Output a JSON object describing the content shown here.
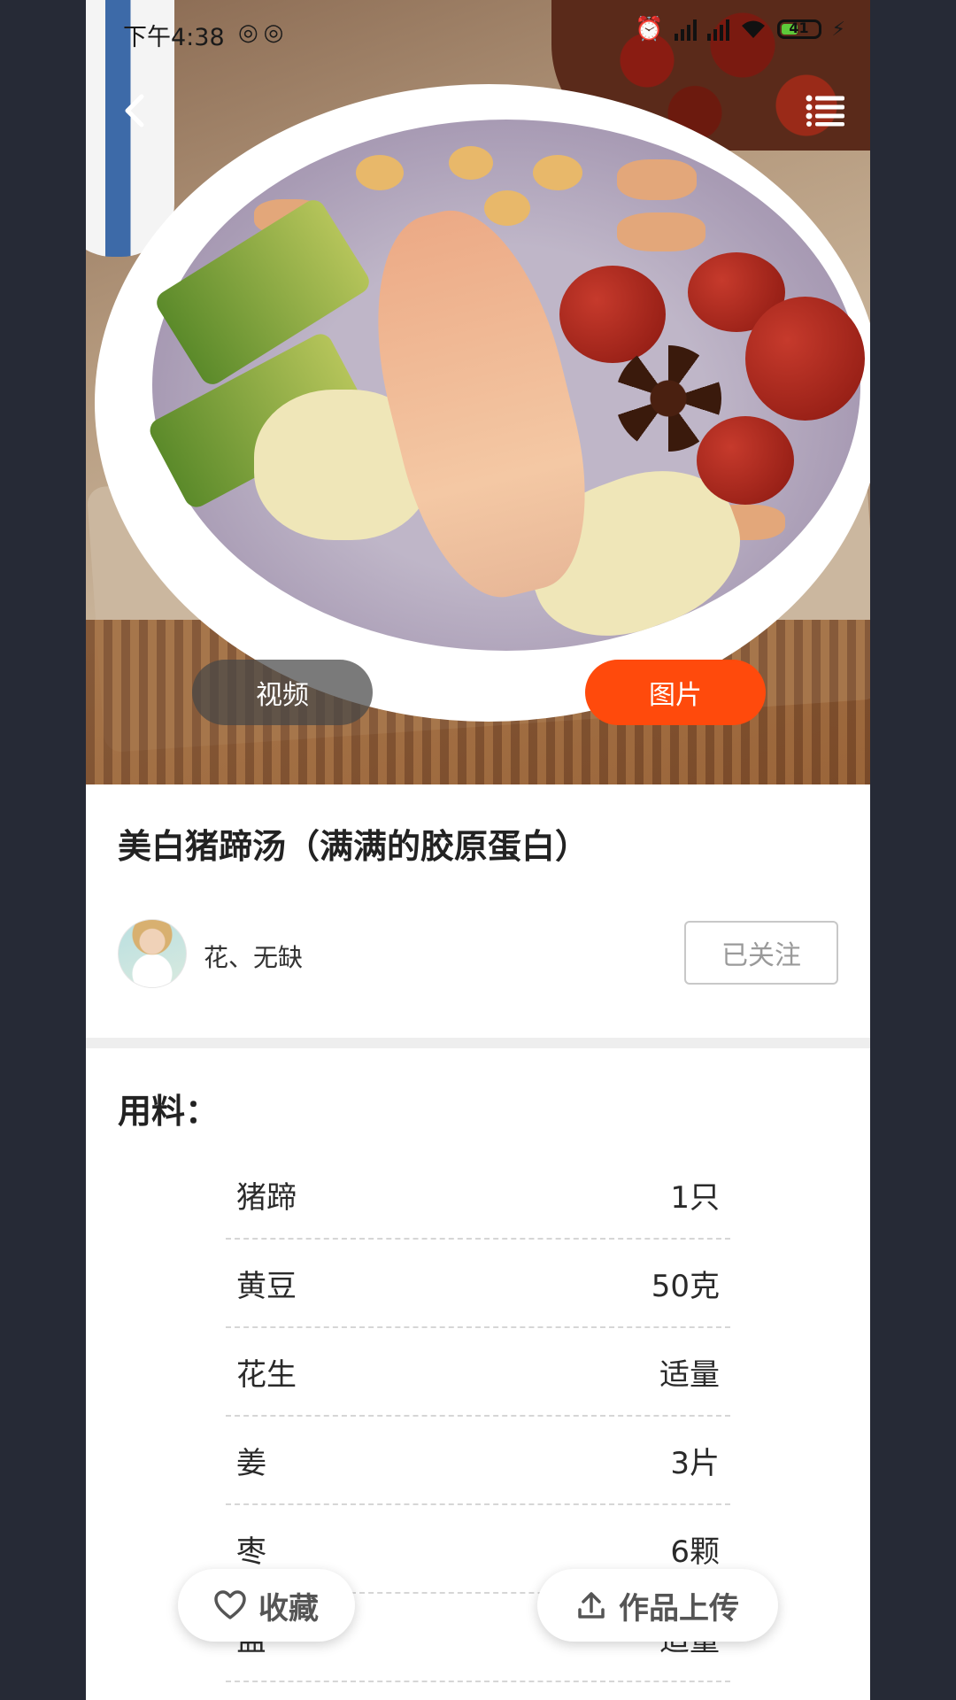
{
  "status_bar": {
    "time": "下午4:38",
    "battery": "41"
  },
  "media_toggle": {
    "video_label": "视频",
    "image_label": "图片",
    "active": "image"
  },
  "recipe": {
    "title": "美白猪蹄汤（满满的胶原蛋白）"
  },
  "author": {
    "name": "花、无缺",
    "follow_label": "已关注"
  },
  "ingredients": {
    "heading": "用料：",
    "items": [
      {
        "name": "猪蹄",
        "amount": "1只"
      },
      {
        "name": "黄豆",
        "amount": "50克"
      },
      {
        "name": "花生",
        "amount": "适量"
      },
      {
        "name": "姜",
        "amount": "3片"
      },
      {
        "name": "枣",
        "amount": "6颗"
      },
      {
        "name": "盐",
        "amount": "适量"
      }
    ]
  },
  "actions": {
    "collect_label": "收藏",
    "upload_label": "作品上传"
  },
  "colors": {
    "accent": "#ff4a0c",
    "side_background": "#262a36"
  }
}
